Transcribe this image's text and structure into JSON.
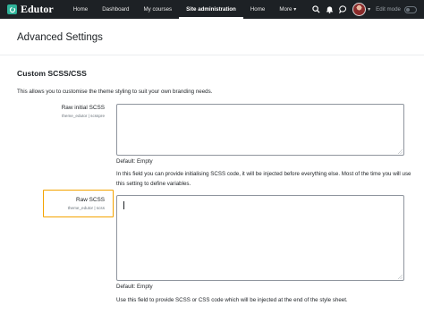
{
  "navbar": {
    "brand": "Edutor",
    "items": [
      {
        "label": "Home",
        "active": false
      },
      {
        "label": "Dashboard",
        "active": false
      },
      {
        "label": "My courses",
        "active": false
      },
      {
        "label": "Site administration",
        "active": true
      },
      {
        "label": "Home",
        "active": false
      },
      {
        "label": "More",
        "active": false
      }
    ],
    "more_caret": "▾",
    "icons": [
      "search-icon",
      "bell-icon",
      "chat-icon"
    ],
    "edit_mode_label": "Edit mode",
    "edit_mode_on": false,
    "colors": {
      "background": "#1d2125",
      "brand": "#2fb39a"
    }
  },
  "page": {
    "title": "Advanced Settings",
    "section_title": "Custom SCSS/CSS",
    "section_description": "This allows you to customise the theme styling to suit your own branding needs."
  },
  "settings": [
    {
      "label": "Raw initial SCSS",
      "key": "theme_edutor | scsspre",
      "value": "",
      "default": "Default: Empty",
      "help": "In this field you can provide initialising SCSS code, it will be injected before everything else. Most of the time you will use this setting to define variables."
    },
    {
      "label": "Raw SCSS",
      "key": "theme_edutor | scss",
      "value": "",
      "default": "Default: Empty",
      "help": "Use this field to provide SCSS or CSS code which will be injected at the end of the style sheet.",
      "highlighted": true
    }
  ],
  "highlight_color": "#f4a300"
}
